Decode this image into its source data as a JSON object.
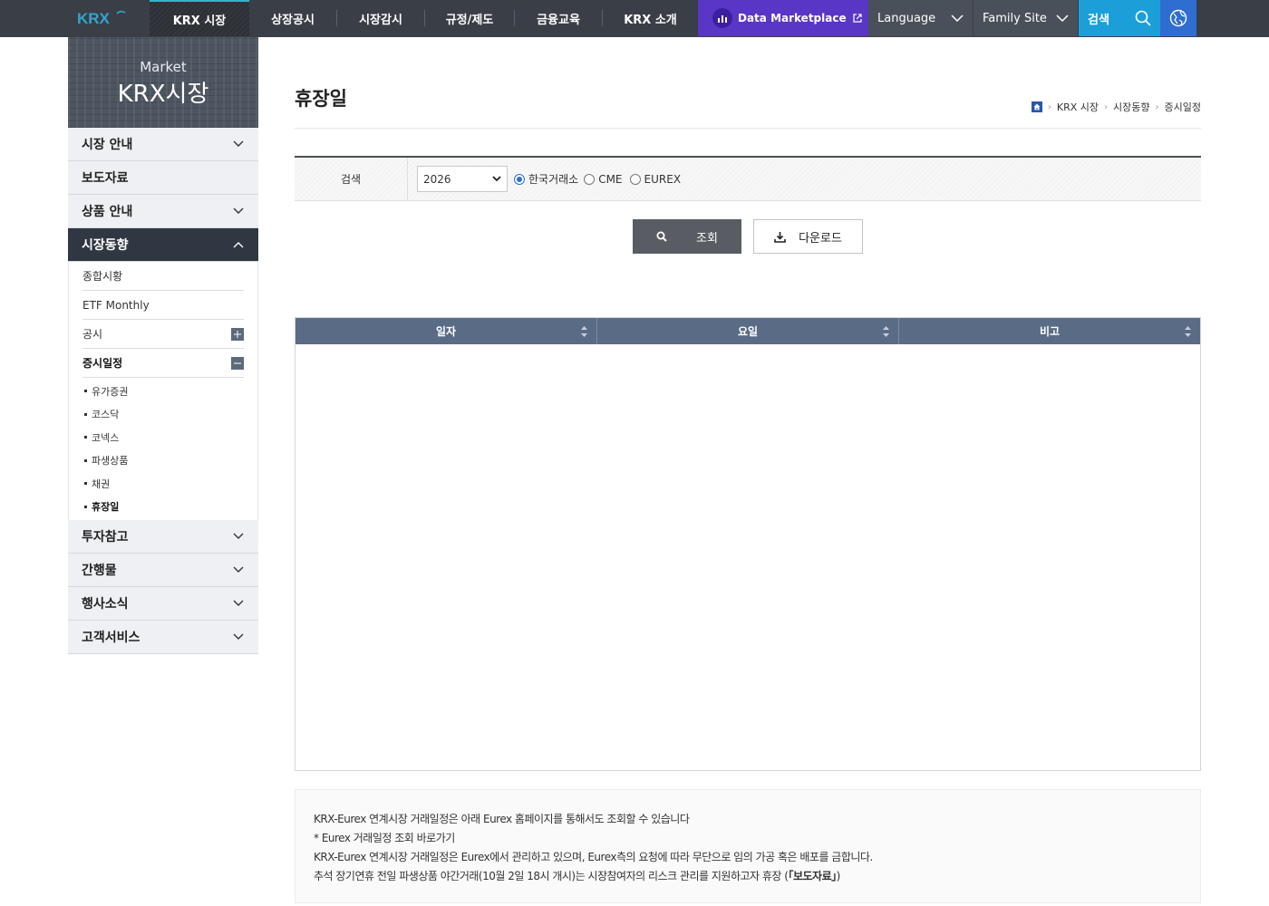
{
  "topnav": {
    "logo": "KRX",
    "items": [
      "KRX 시장",
      "상장공시",
      "시장감시",
      "규정/제도",
      "금융교육",
      "KRX 소개"
    ],
    "data_marketplace": "Data Marketplace",
    "language": "Language",
    "family_site": "Family Site",
    "search": "검색"
  },
  "sidebar": {
    "banner_sub": "Market",
    "banner_title": "KRX시장",
    "menu": [
      "시장 안내",
      "보도자료",
      "상품 안내",
      "시장동향",
      "투자참고",
      "간행물",
      "행사소식",
      "고객서비스"
    ],
    "submenu": [
      "종합시황",
      "ETF Monthly",
      "공시",
      "증시일정"
    ],
    "subsub": [
      "유가증권",
      "코스닥",
      "코넥스",
      "파생상품",
      "채권",
      "휴장일"
    ]
  },
  "page": {
    "title": "휴장일",
    "breadcrumb": [
      "KRX 시장",
      "시장동향",
      "증시일정"
    ]
  },
  "search": {
    "label": "검색",
    "year": "2026",
    "options": [
      "한국거래소",
      "CME",
      "EUREX"
    ],
    "selected": "한국거래소",
    "query_button": "조회",
    "download_button": "다운로드"
  },
  "table": {
    "columns": [
      "일자",
      "요일",
      "비고"
    ],
    "rows": []
  },
  "notice": {
    "line1": "KRX-Eurex 연계시장 거래일정은 아래 Eurex 홈페이지를 통해서도 조회할 수 있습니다",
    "line2": "* Eurex 거래일정 조회 바로가기",
    "line3": "KRX-Eurex 연계시장 거래일정은 Eurex에서 관리하고 있으며, Eurex측의 요청에 따라 무단으로 임의 가공 혹은 배포를 금합니다.",
    "line4_prefix": "추석 장기연휴 전일 파생상품 야간거래(10월 2일 18시 개시)는 시장참여자의 리스크 관리를 지원하고자 휴장 (",
    "line4_link": "「보도자료」",
    "line4_suffix": ")"
  },
  "colors": {
    "topbar": "#3a3f47",
    "accent": "#36b3c9",
    "marketplace": "#5a36c7",
    "search": "#1c9fd9",
    "grid_head": "#5a6b86"
  }
}
